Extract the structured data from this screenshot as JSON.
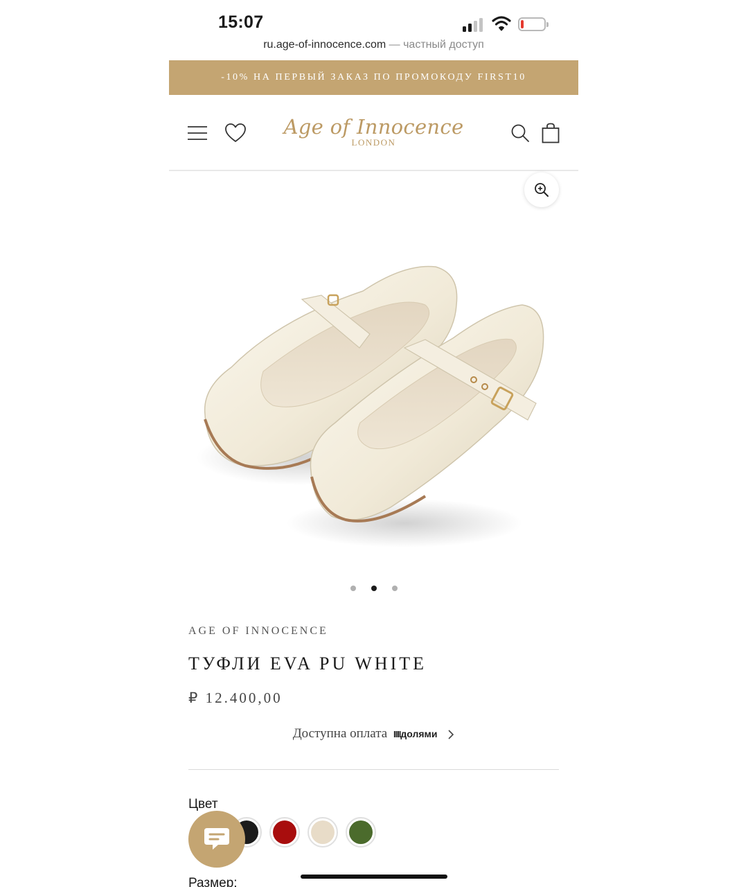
{
  "status_bar": {
    "time": "15:07",
    "battery_color": "#e53a2f"
  },
  "browser": {
    "url": "ru.age-of-innocence.com",
    "privacy_note": "— частный доступ"
  },
  "promo": {
    "text": "-10% НА ПЕРВЫЙ ЗАКАЗ ПО ПРОМОКОДУ FIRST10",
    "background": "#c4a572"
  },
  "header": {
    "logo_script": "Age of Innocence",
    "logo_sub": "LONDON",
    "brand_color": "#bc9a64",
    "icons": [
      "menu-icon",
      "heart-icon",
      "search-icon",
      "bag-icon"
    ]
  },
  "gallery": {
    "image_alt": "product-shoes",
    "slide_count": 3,
    "active_slide": 2
  },
  "product": {
    "brand": "AGE OF INNOCENCE",
    "title": "ТУФЛИ EVA PU WHITE",
    "price": "₽ 12.400,00",
    "payment_text": "Доступна оплата",
    "payment_provider": "долями",
    "payment_provider_mark": "IIII"
  },
  "options": {
    "color_label": "Цвет",
    "colors": [
      {
        "name": "black",
        "hex": "#1b1b1b"
      },
      {
        "name": "red",
        "hex": "#a80d0d"
      },
      {
        "name": "white",
        "hex": "#e8dcc8"
      },
      {
        "name": "green",
        "hex": "#4b6b2c"
      }
    ],
    "size_label": "Размер:"
  },
  "chat": {
    "icon": "chat-icon"
  }
}
